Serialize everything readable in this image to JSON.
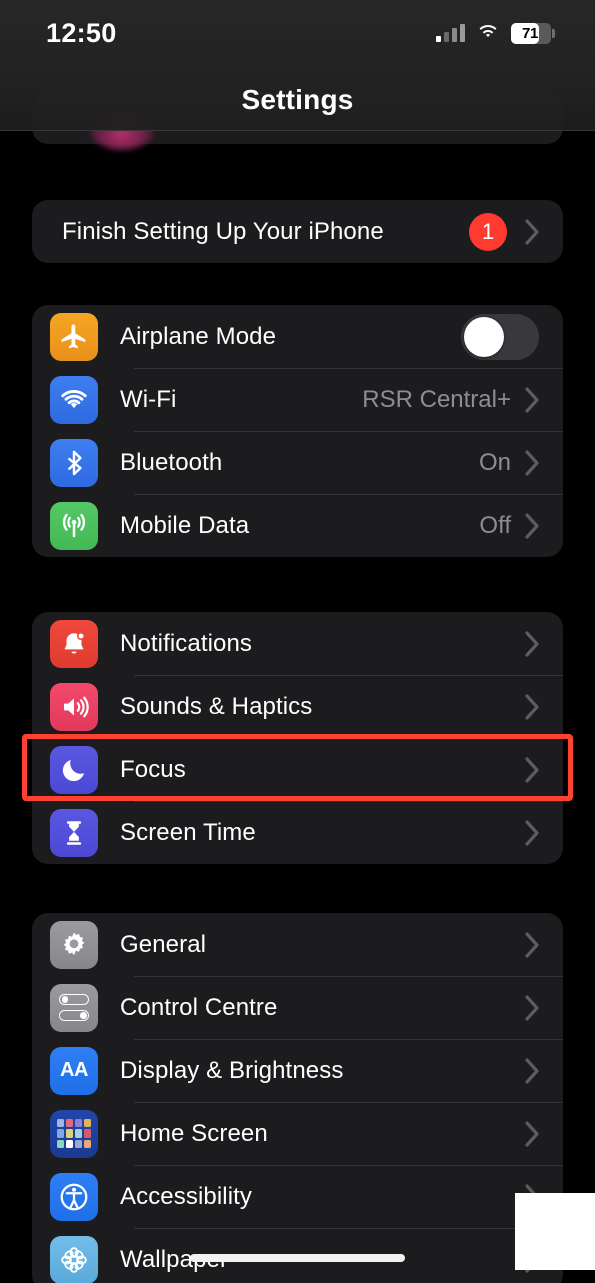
{
  "statusbar": {
    "time": "12:50",
    "signal_icon": "cellular-signal-icon",
    "wifi_icon": "wifi-icon",
    "battery_icon": "battery-icon",
    "battery_percent": "71",
    "battery_level": 71
  },
  "header": {
    "title": "Settings"
  },
  "colors": {
    "background": "#000000",
    "card": "#1c1c1e",
    "separator": "#333336",
    "label": "#ffffff",
    "value": "#8d8d93",
    "chevron": "#5c5c61",
    "badge": "#ff3b30",
    "highlight": "#ff4230",
    "toggle_off_track": "#39393d",
    "toggle_knob": "#ffffff"
  },
  "sections": [
    {
      "id": "setup",
      "rows": [
        {
          "id": "finish-setup",
          "label": "Finish Setting Up Your iPhone",
          "badge": "1",
          "accessory": "chevron",
          "icon": null
        }
      ]
    },
    {
      "id": "connectivity",
      "rows": [
        {
          "id": "airplane-mode",
          "label": "Airplane Mode",
          "icon": "airplane-icon",
          "icon_color": "#f5a623",
          "accessory": "toggle",
          "toggle_on": false
        },
        {
          "id": "wifi",
          "label": "Wi-Fi",
          "icon": "wifi-icon",
          "icon_color": "#3d7ef0",
          "value": "RSR Central+",
          "accessory": "chevron"
        },
        {
          "id": "bluetooth",
          "label": "Bluetooth",
          "icon": "bluetooth-icon",
          "icon_color": "#3d7ef0",
          "value": "On",
          "accessory": "chevron"
        },
        {
          "id": "mobile-data",
          "label": "Mobile Data",
          "icon": "cellular-icon",
          "icon_color": "#53c865",
          "value": "Off",
          "accessory": "chevron"
        }
      ]
    },
    {
      "id": "alerts",
      "rows": [
        {
          "id": "notifications",
          "label": "Notifications",
          "icon": "bell-icon",
          "icon_color": "#f0483c",
          "accessory": "chevron"
        },
        {
          "id": "sounds-haptics",
          "label": "Sounds & Haptics",
          "icon": "speaker-icon",
          "icon_color": "#f2496b",
          "accessory": "chevron"
        },
        {
          "id": "focus",
          "label": "Focus",
          "icon": "moon-icon",
          "icon_color": "#5a57e0",
          "accessory": "chevron",
          "highlighted": true
        },
        {
          "id": "screen-time",
          "label": "Screen Time",
          "icon": "hourglass-icon",
          "icon_color": "#5a57e0",
          "accessory": "chevron"
        }
      ]
    },
    {
      "id": "system",
      "rows": [
        {
          "id": "general",
          "label": "General",
          "icon": "gear-icon",
          "icon_color": "#9a9a9f",
          "accessory": "chevron"
        },
        {
          "id": "control-centre",
          "label": "Control Centre",
          "icon": "toggles-icon",
          "icon_color": "#9a9a9f",
          "accessory": "chevron"
        },
        {
          "id": "display-brightness",
          "label": "Display & Brightness",
          "icon": "text-size-icon",
          "icon_color": "#2f7ef5",
          "accessory": "chevron"
        },
        {
          "id": "home-screen",
          "label": "Home Screen",
          "icon": "app-grid-icon",
          "icon_color": "#2246a8",
          "accessory": "chevron"
        },
        {
          "id": "accessibility",
          "label": "Accessibility",
          "icon": "accessibility-icon",
          "icon_color": "#2f7ef5",
          "accessory": "chevron"
        },
        {
          "id": "wallpaper",
          "label": "Wallpaper",
          "icon": "flower-icon",
          "icon_color": "#72bde8",
          "accessory": "chevron"
        }
      ]
    }
  ],
  "overlays": {
    "highlight_target": "focus",
    "white_patch": "white-rectangle-overlay",
    "home_indicator": "home-indicator"
  }
}
